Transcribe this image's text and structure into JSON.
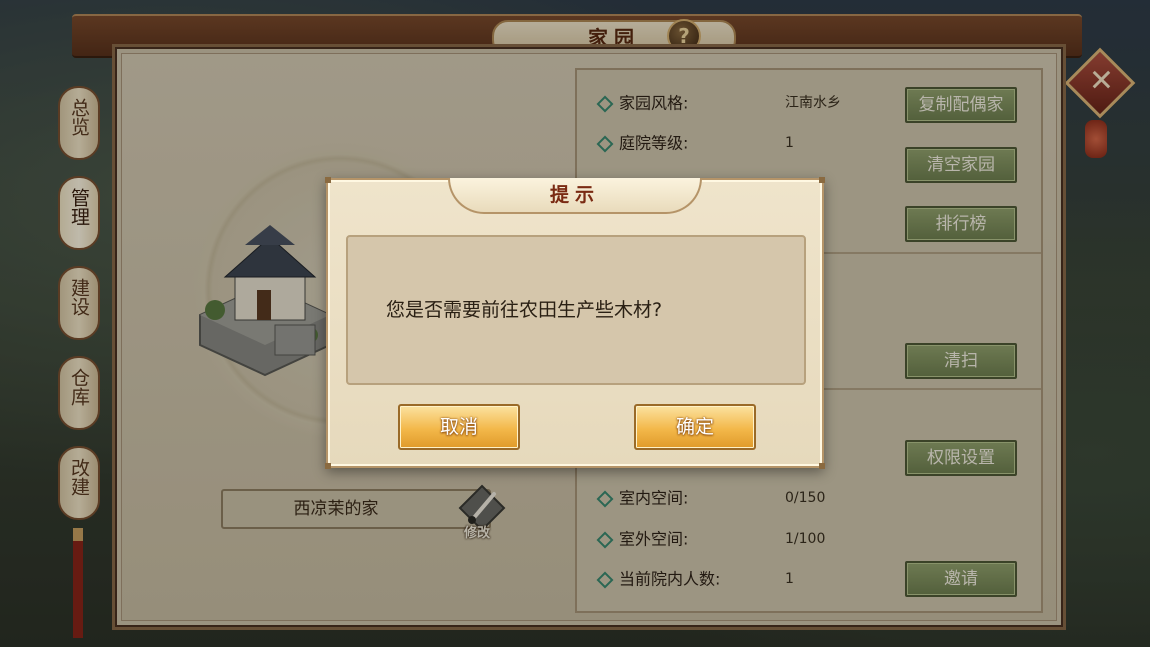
{
  "window": {
    "title": "家园",
    "help_icon": "question-mark-icon",
    "close_icon": "close-icon"
  },
  "side_tabs": [
    {
      "label": "总览",
      "active": false
    },
    {
      "label": "管理",
      "active": true
    },
    {
      "label": "建设",
      "active": false
    },
    {
      "label": "仓库",
      "active": false
    },
    {
      "label": "改建",
      "active": false
    }
  ],
  "home": {
    "name": "西凉茉的家",
    "modify_label": "修改",
    "modify_icon": "brush-icon"
  },
  "info": {
    "rows": [
      {
        "label": "家园风格:",
        "value": "江南水乡"
      },
      {
        "label": "庭院等级:",
        "value": "1"
      },
      {
        "label": "室内空间:",
        "value": "0/150"
      },
      {
        "label": "室外空间:",
        "value": "1/100"
      },
      {
        "label": "当前院内人数:",
        "value": "1"
      }
    ],
    "buttons": {
      "copy_spouse": "复制配偶家",
      "clear_home": "清空家园",
      "ranking": "排行榜",
      "sweep": "清扫",
      "permissions": "权限设置",
      "invite": "邀请"
    }
  },
  "modal": {
    "title": "提示",
    "message": "您是否需要前往农田生产些木材?",
    "cancel_label": "取消",
    "confirm_label": "确定"
  },
  "colors": {
    "frame_brown": "#7a4a2c",
    "panel_beige": "#d1c7ae",
    "green_button": "#7f9060",
    "gold_button": "#f3b84a",
    "title_red": "#7a2a12"
  }
}
